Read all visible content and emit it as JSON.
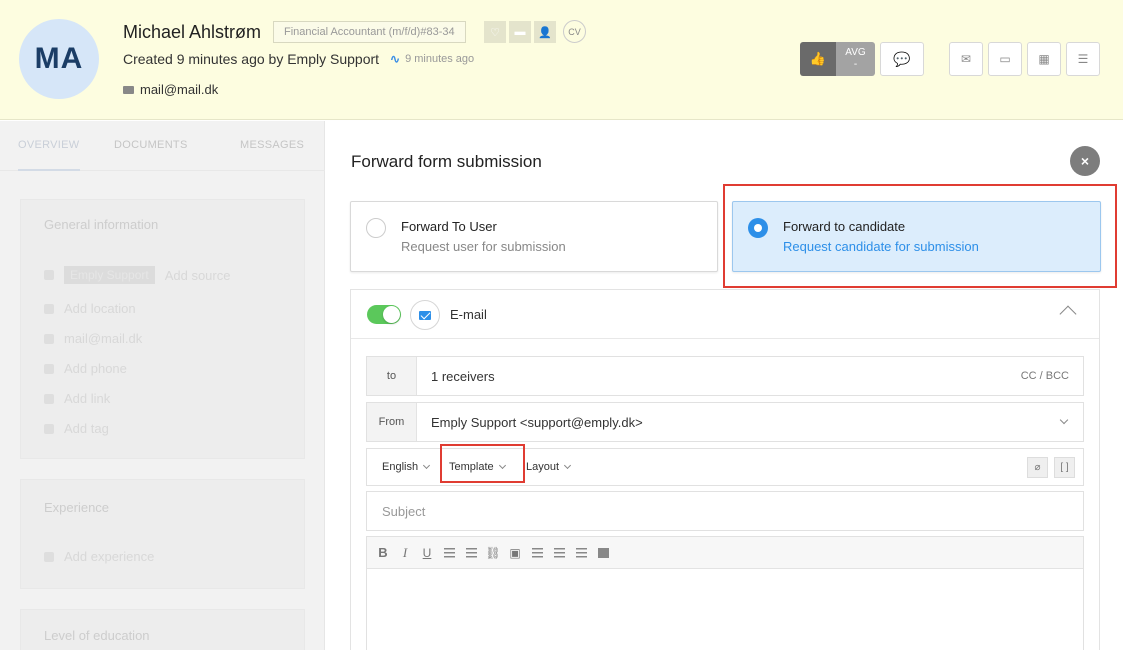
{
  "candidate": {
    "initials": "MA",
    "name": "Michael Ahlstrøm",
    "job": "Financial Accountant (m/f/d)#83-34",
    "created": "Created 9 minutes ago by Emply Support",
    "activity": "9 minutes ago",
    "email": "mail@mail.dk",
    "cv_label": "CV"
  },
  "rating": {
    "avg_label": "AVG",
    "avg_value": "-"
  },
  "left_panel": {
    "tabs": [
      "OVERVIEW",
      "DOCUMENTS",
      "MESSAGES"
    ],
    "general_title": "General information",
    "source_chip": "Emply Support",
    "add_source": "Add source",
    "add_location": "Add location",
    "email": "mail@mail.dk",
    "add_phone": "Add phone",
    "add_link": "Add link",
    "add_tag": "Add tag",
    "experience_title": "Experience",
    "add_experience": "Add experience",
    "education_title": "Level of education"
  },
  "modal": {
    "title": "Forward form submission",
    "close": "×",
    "option_user": {
      "title": "Forward To User",
      "subtitle": "Request user for submission"
    },
    "option_candidate": {
      "title": "Forward to candidate",
      "subtitle": "Request candidate for submission"
    },
    "email_label": "E-mail",
    "to_label": "to",
    "to_value": "1 receivers",
    "cc_bcc": "CC / BCC",
    "from_label": "From",
    "from_value": "Emply Support <support@emply.dk>",
    "language": "English",
    "template": "Template",
    "layout": "Layout",
    "subject_placeholder": "Subject"
  },
  "colors": {
    "accent": "#2d8fe8",
    "highlight": "#e03c32",
    "toggle_on": "#5bc85b",
    "header_bg": "#fdfde0"
  },
  "icons": {
    "editor": [
      "bold-icon",
      "italic-icon",
      "underline-icon",
      "ordered-list-icon",
      "unordered-list-icon",
      "link-icon",
      "image-icon",
      "align-left-icon",
      "align-center-icon",
      "align-right-icon",
      "justify-icon"
    ]
  }
}
